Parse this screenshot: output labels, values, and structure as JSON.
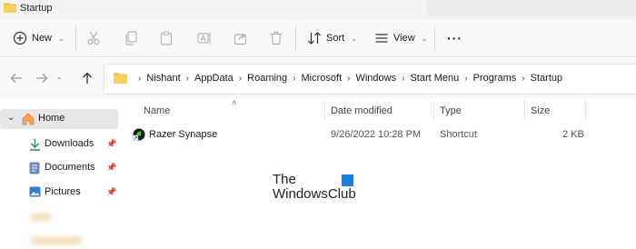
{
  "window": {
    "title": "Startup"
  },
  "toolbar": {
    "new_label": "New",
    "sort_label": "Sort",
    "view_label": "View",
    "more_label": "···"
  },
  "address": {
    "crumbs": [
      "Nishant",
      "AppData",
      "Roaming",
      "Microsoft",
      "Windows",
      "Start Menu",
      "Programs",
      "Startup"
    ]
  },
  "sidebar": {
    "items": [
      {
        "label": "Home",
        "icon": "home-icon"
      },
      {
        "label": "Downloads",
        "icon": "download-icon",
        "pinned": true
      },
      {
        "label": "Documents",
        "icon": "documents-icon",
        "pinned": true
      },
      {
        "label": "Pictures",
        "icon": "pictures-icon",
        "pinned": true
      }
    ]
  },
  "columns": {
    "name": "Name",
    "date": "Date modified",
    "type": "Type",
    "size": "Size"
  },
  "files": [
    {
      "name": "Razer Synapse",
      "date": "9/26/2022 10:28 PM",
      "type": "Shortcut",
      "size": "2 KB",
      "icon": "razer-shortcut-icon"
    }
  ],
  "watermark": {
    "line1": "The",
    "line2": "WindowsClub"
  },
  "colors": {
    "accent": "#1e7fd6",
    "folder": "#f4c542",
    "selected": "#e6e6e6"
  }
}
